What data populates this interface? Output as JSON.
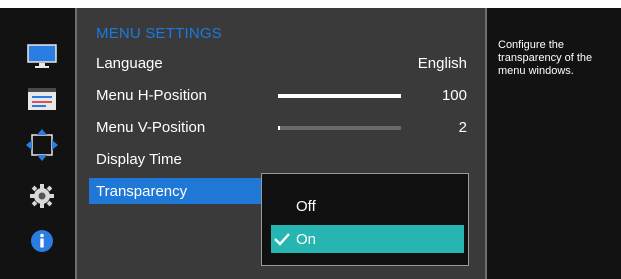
{
  "menu": {
    "title": "MENU SETTINGS",
    "items": [
      {
        "label": "Language",
        "value": "English"
      },
      {
        "label": "Menu H-Position",
        "value": "100",
        "level": 1.0
      },
      {
        "label": "Menu V-Position",
        "value": "2",
        "level": 0.02
      },
      {
        "label": "Display Time"
      },
      {
        "label": "Transparency"
      }
    ]
  },
  "transparency_popup": {
    "options": [
      "Off",
      "On"
    ],
    "selected": "On"
  },
  "help_text": "Configure the transparency of the menu windows.",
  "sidebar": {
    "icons": [
      "picture-icon",
      "onscreen-display-icon",
      "position-icon",
      "system-icon",
      "information-icon"
    ]
  },
  "colors": {
    "title": "#1a7ae0",
    "selected_row": "#1f77d6",
    "active_option": "#27b5b2",
    "background": "#121212",
    "panel": "#3a3a3a"
  }
}
